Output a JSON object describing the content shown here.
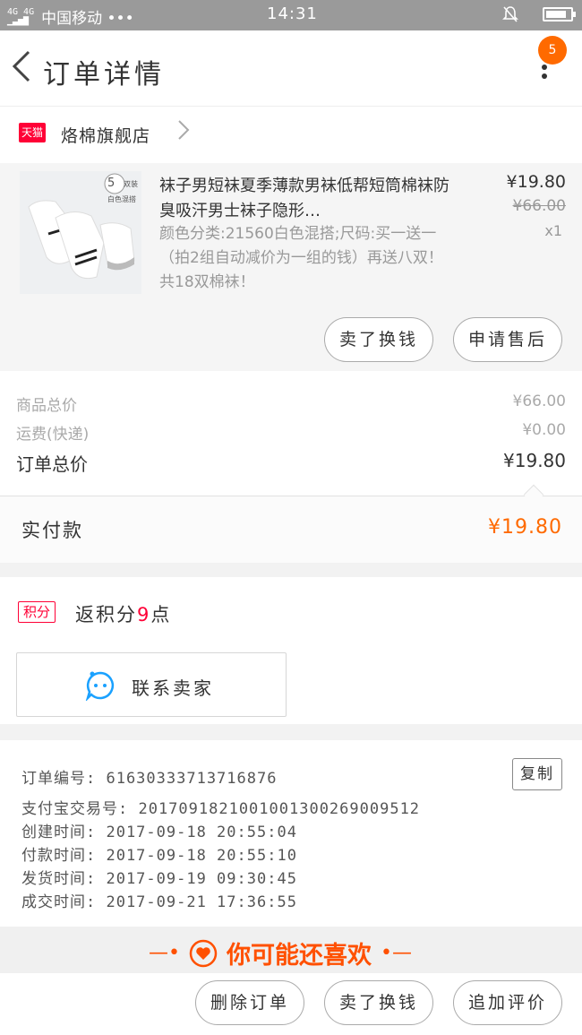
{
  "status_bar": {
    "network": "4G 4G",
    "carrier": "中国移动 •••",
    "time": "14:31",
    "icons": [
      "signal-icon",
      "bell-muted-icon",
      "battery-icon"
    ],
    "battery_level": 0.85
  },
  "header": {
    "title": "订单详情",
    "cart_badge": "5",
    "accent": "#ff6a00"
  },
  "store": {
    "platform_badge": "天猫",
    "name": "烙棉旗舰店"
  },
  "product": {
    "image_tag_num": "5",
    "image_tag_unit": "双装",
    "image_tag_sub": "白色混搭",
    "title": "袜子男短袜夏季薄款男袜低帮短筒棉袜防臭吸汗男士袜子隐形…",
    "spec": "颜色分类:21560白色混搭;尺码:买一送一（拍2组自动减价为一组的钱）再送八双！共18双棉袜！",
    "price": "¥19.80",
    "original_price": "¥66.00",
    "quantity": "x1",
    "buttons": [
      "卖了换钱",
      "申请售后"
    ]
  },
  "summary": {
    "rows": [
      {
        "label": "商品总价",
        "value": "¥66.00"
      },
      {
        "label": "运费(快递)",
        "value": "¥0.00"
      },
      {
        "label": "订单总价",
        "value": "¥19.80"
      }
    ],
    "paid_label": "实付款",
    "paid_value": "¥19.80"
  },
  "points": {
    "badge": "积分",
    "text_before": "返积分",
    "count": "9",
    "text_after": "点"
  },
  "contact": {
    "label": "联系卖家"
  },
  "order_info": {
    "order_no": "订单编号: 61630333713716876",
    "copy_label": "复制",
    "alipay_no": "支付宝交易号: 2017091821001001300269009512",
    "created": "创建时间: 2017-09-18 20:55:04",
    "paid": "付款时间: 2017-09-18 20:55:10",
    "shipped": "发货时间: 2017-09-19 09:30:45",
    "completed": "成交时间: 2017-09-21 17:36:55"
  },
  "recommend": {
    "title": "你可能还喜欢"
  },
  "footer": {
    "buttons": [
      "删除订单",
      "卖了换钱",
      "追加评价"
    ]
  }
}
